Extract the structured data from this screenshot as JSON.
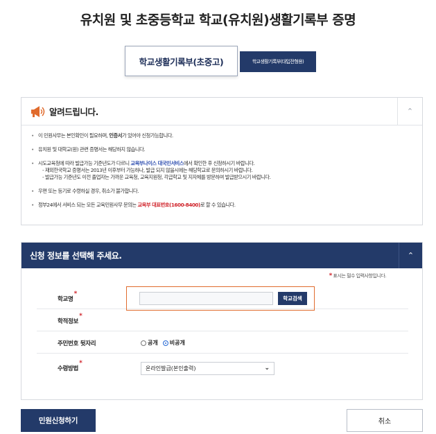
{
  "page": {
    "title": "유치원 및 초중등학교 학교(유치원)생활기록부 증명"
  },
  "tabs": [
    {
      "label": "학교생활기록부(초중고)"
    },
    {
      "label": "학교생활기록부(대입전형용)"
    }
  ],
  "notice": {
    "title": "알려드립니다.",
    "items": [
      {
        "a": "이 민원사무는 본인확인이 필요하며, ",
        "b": "인증서",
        "c": "가 있어야 신청가능합니다."
      },
      {
        "a": "유치원 및 대학교(원) 관련 증명서는 해당하지 않습니다."
      },
      {
        "a": "시도교육청에 따라 발급가능 기준년도가 다르니 ",
        "b": "교육부나이스 대국민서비스",
        "c": "에서 확인한 후 신청하시기 바랍니다."
      },
      {
        "a": "- 재외한국학교 증명서는 2013년 이후부터 가능하나, 발급 되지 않을시에는 해당학교로 문의하시기 바랍니다."
      },
      {
        "a": "- 발급가능 기준년도 이전 졸업자는 가까운 교육청, 교육지원청, 각급학교 및 지자체를 방문하여 발급받으시기 바랍니다."
      },
      {
        "a": "우편 또는 등기로 수령하실 경우, 취소가 불가합니다."
      },
      {
        "a": "정부24에서 서비스 되는 모든 교육민원사무 문의는 ",
        "b": "교육부 대표번호(1600-8400)",
        "c": "로 할 수 있습니다."
      }
    ]
  },
  "form": {
    "title": "신청 정보를 선택해 주세요.",
    "required_note": "표시는 필수 입력사항입니다.",
    "required_mark": "*",
    "school": {
      "label": "학교명",
      "value": "",
      "button": "학교검색"
    },
    "record": {
      "label": "학적정보"
    },
    "rrn": {
      "label": "주민번호 뒷자리",
      "options": [
        "공개",
        "비공개"
      ],
      "selected": "비공개"
    },
    "receipt": {
      "label": "수령방법",
      "selected": "온라인발급(본인출력)"
    }
  },
  "actions": {
    "apply": "민원신청하기",
    "cancel": "취소"
  },
  "colors": {
    "navy": "#233a69",
    "required": "#d0242b",
    "highlight": "#e06b2d"
  }
}
